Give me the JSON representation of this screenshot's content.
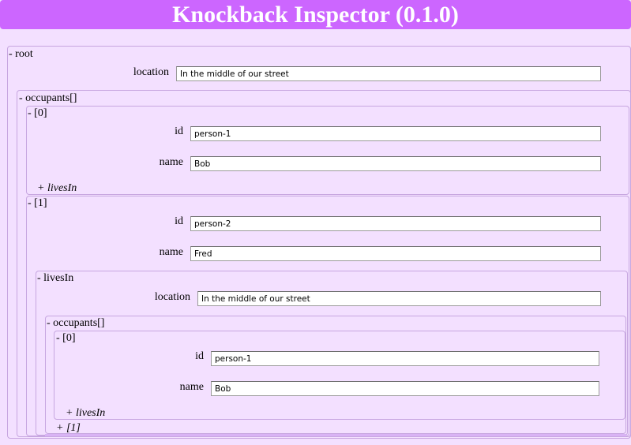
{
  "header": {
    "title": "Knockback Inspector (0.1.0)"
  },
  "root": {
    "toggle": "- root",
    "location_label": "location",
    "location_value": "In the middle of our street",
    "occupants": {
      "toggle": "- occupants[]",
      "items": [
        {
          "toggle": "- [0]",
          "id_label": "id",
          "id_value": "person-1",
          "name_label": "name",
          "name_value": "Bob",
          "lives_in_toggle": "+ livesIn"
        },
        {
          "toggle": "- [1]",
          "id_label": "id",
          "id_value": "person-2",
          "name_label": "name",
          "name_value": "Fred",
          "lives_in": {
            "toggle": "- livesIn",
            "location_label": "location",
            "location_value": "In the middle of our street",
            "occupants": {
              "toggle": "- occupants[]",
              "items": [
                {
                  "toggle": "- [0]",
                  "id_label": "id",
                  "id_value": "person-1",
                  "name_label": "name",
                  "name_value": "Bob",
                  "lives_in_toggle": "+ livesIn"
                }
              ],
              "more_toggle": "+ [1]"
            }
          }
        }
      ]
    }
  }
}
